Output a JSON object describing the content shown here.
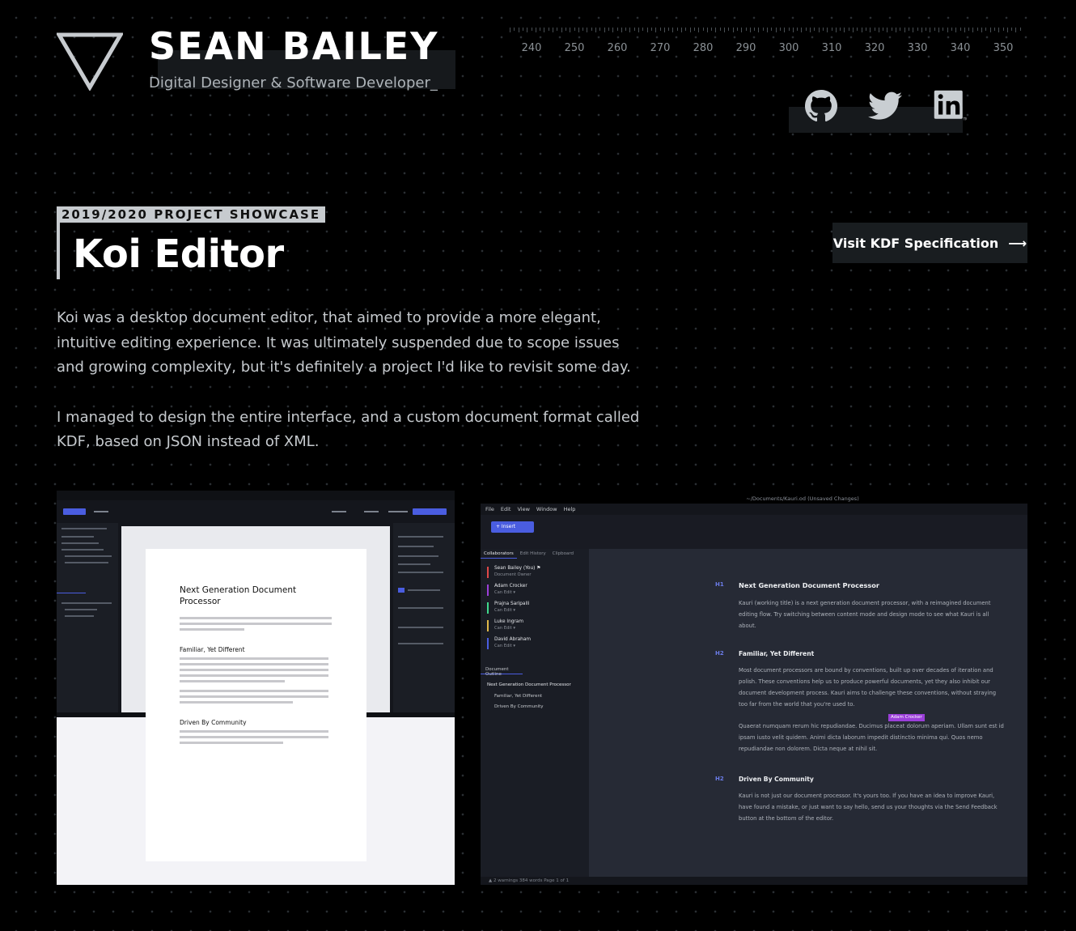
{
  "header": {
    "name": "SEAN BAILEY",
    "tagline": "Digital Designer & Software Developer_",
    "ruler_labels": [
      "240",
      "250",
      "260",
      "270",
      "280",
      "290",
      "300",
      "310",
      "320",
      "330",
      "340",
      "350"
    ],
    "social": [
      {
        "icon": "github-icon",
        "label": "GitHub"
      },
      {
        "icon": "twitter-icon",
        "label": "Twitter"
      },
      {
        "icon": "linkedin-icon",
        "label": "LinkedIn"
      }
    ]
  },
  "project": {
    "kicker": "2019/2020 PROJECT SHOWCASE",
    "title": "Koi Editor",
    "visit_label": "Visit KDF Specification",
    "visit_arrow": "⟶",
    "description": [
      "Koi was a desktop document editor, that aimed to provide a more elegant, intuitive editing experience. It was ultimately suspended due to scope issues and growing complexity, but it's definitely a project I'd like to revisit some day.",
      "I managed to design the entire interface, and a custom document format called KDF, based on JSON instead of XML."
    ]
  },
  "screenshot1": {
    "doc_title": "Next Generation Document Processor",
    "section1": "Familiar, Yet Different",
    "section2": "Driven By Community"
  },
  "screenshot2": {
    "window_title": "~/Documents/Kauri.od  (Unsaved Changes)",
    "menu": [
      "File",
      "Edit",
      "View",
      "Window",
      "Help"
    ],
    "insert_label": "+   Insert",
    "tabs": [
      "Collaborators",
      "Edit History",
      "Clipboard"
    ],
    "collaborators": [
      {
        "name": "Sean Bailey (You)  ⚑",
        "role": "Document Owner",
        "color": "#e04848"
      },
      {
        "name": "Adam Crocker",
        "role": "Can Edit  ▾",
        "color": "#9b3fd9"
      },
      {
        "name": "Prajna Saripalli",
        "role": "Can Edit  ▾",
        "color": "#3fd98b"
      },
      {
        "name": "Luke Ingram",
        "role": "Can Edit  ▾",
        "color": "#e0b848"
      },
      {
        "name": "David Abraham",
        "role": "Can Edit  ▾",
        "color": "#4a5de0"
      }
    ],
    "outline_label": "Document Outline",
    "outline": [
      "Next Generation Document Processor",
      "Familiar, Yet Different",
      "Driven By Community"
    ],
    "doc": {
      "h1_tag": "H1",
      "h1": "Next Generation Document Processor",
      "p1": "Kauri (working title) is a next generation document processor, with a reimagined document editing flow. Try switching between content mode and design mode to see what Kauri is all about.",
      "h2a_tag": "H2",
      "h2a": "Familiar, Yet Different",
      "p2": "Most document processors are bound by conventions, built up over decades of iteration and polish. These conventions help us to produce powerful documents, yet they also inhibit our document development process. Kauri aims to challenge these conventions, without straying too far from the world that you're used to.",
      "p3": "Quaerat numquam rerum hic repudiandae. Ducimus placeat dolorum aperiam. Ullam sunt est id ipsam iusto velit quidem. Animi dicta laborum impedit distinctio minima qui. Quos nemo repudiandae non dolorem. Dicta neque at nihil sit.",
      "cursor_user": "Adam Crocker",
      "h2b_tag": "H2",
      "h2b": "Driven By Community",
      "p4": "Kauri is not just our document processor. It's yours too. If you have an idea to improve Kauri, have found a mistake, or just want to say hello, send us your thoughts via the Send Feedback button at the bottom of the editor."
    },
    "status": "▲ 2 warnings      384 words      Page 1 of 1"
  }
}
